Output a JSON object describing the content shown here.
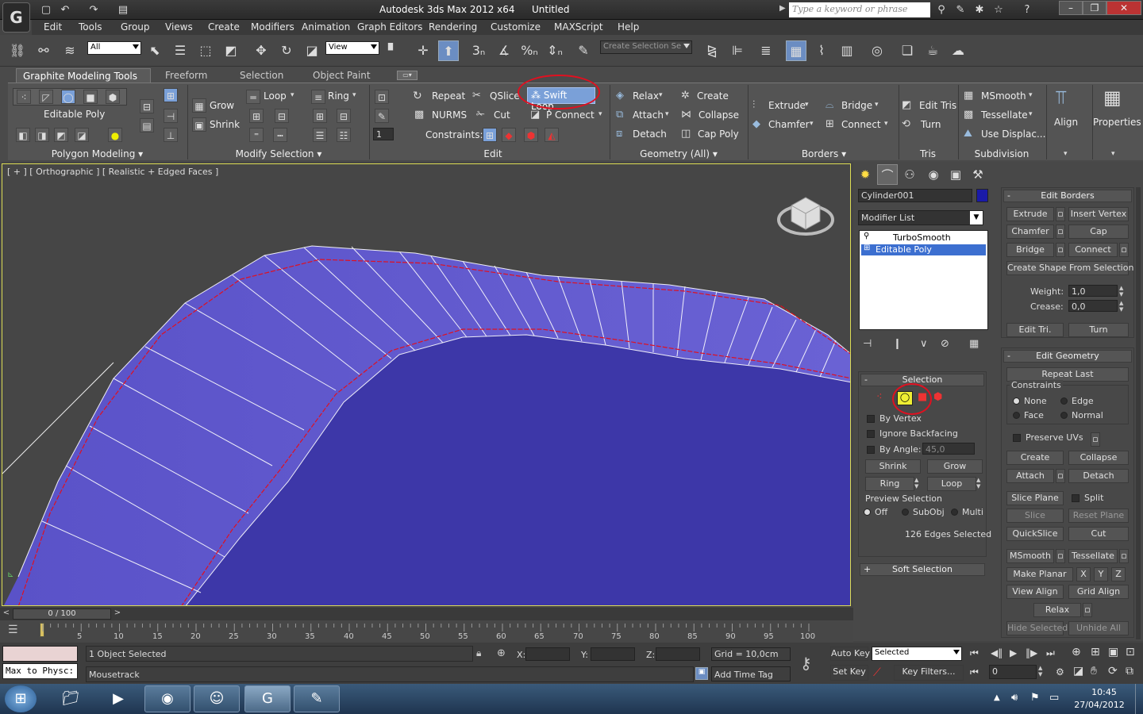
{
  "title_bar": {
    "app_title": "Autodesk 3ds Max  2012 x64",
    "doc_title": "Untitled",
    "search_placeholder": "Type a keyword or phrase"
  },
  "menu": [
    "Edit",
    "Tools",
    "Group",
    "Views",
    "Create",
    "Modifiers",
    "Animation",
    "Graph Editors",
    "Rendering",
    "Customize",
    "MAXScript",
    "Help"
  ],
  "toolbar": {
    "filter_value": "All",
    "refcoord_value": "View",
    "selection_set_placeholder": "Create Selection Se"
  },
  "ribbon": {
    "tabs": [
      "Graphite Modeling Tools",
      "Freeform",
      "Selection",
      "Object Paint"
    ],
    "polygon_modeling": {
      "editable_poly": "Editable Poly",
      "title": "Polygon Modeling"
    },
    "modify_selection": {
      "grow": "Grow",
      "shrink": "Shrink",
      "loop": "Loop",
      "ring": "Ring",
      "title": "Modify Selection"
    },
    "edit": {
      "repeat": "Repeat",
      "qslice": "QSlice",
      "swift_loop": "Swift Loop",
      "nurms": "NURMS",
      "cut": "Cut",
      "p_connect": "P Connect",
      "constraints": "Constraints:",
      "title": "Edit",
      "spinner": "1"
    },
    "geometry": {
      "relax": "Relax",
      "create": "Create",
      "attach": "Attach",
      "collapse": "Collapse",
      "detach": "Detach",
      "cap_poly": "Cap Poly",
      "title": "Geometry (All)"
    },
    "borders": {
      "extrude": "Extrude",
      "bridge": "Bridge",
      "chamfer": "Chamfer",
      "connect": "Connect",
      "title": "Borders"
    },
    "tris": {
      "edit_tris": "Edit Tris",
      "turn": "Turn",
      "title": "Tris"
    },
    "subdivision": {
      "msmooth": "MSmooth",
      "tessellate": "Tessellate",
      "use_displac": "Use Displac...",
      "title": "Subdivision"
    },
    "align": "Align",
    "properties": "Properties"
  },
  "viewport": {
    "label": "[ + ] [ Orthographic ] [ Realistic + Edged Faces ]"
  },
  "command_panel": {
    "object_name": "Cylinder001",
    "object_color": "#1a1aa8",
    "modifier_list": "Modifier List",
    "stack": [
      "TurboSmooth",
      "Editable Poly"
    ],
    "selection": {
      "title": "Selection",
      "by_vertex": "By Vertex",
      "ignore_backfacing": "Ignore Backfacing",
      "by_angle": "By Angle:",
      "angle_value": "45,0",
      "shrink": "Shrink",
      "grow": "Grow",
      "ring": "Ring",
      "loop": "Loop",
      "preview_title": "Preview Selection",
      "off": "Off",
      "subobj": "SubObj",
      "multi": "Multi",
      "count": "126 Edges Selected"
    },
    "soft_selection": "Soft Selection",
    "edit_borders": {
      "title": "Edit Borders",
      "extrude": "Extrude",
      "insert_vertex": "Insert Vertex",
      "chamfer": "Chamfer",
      "cap": "Cap",
      "bridge": "Bridge",
      "connect": "Connect",
      "create_shape": "Create Shape From Selection",
      "weight": "Weight:",
      "weight_val": "1,0",
      "crease": "Crease:",
      "crease_val": "0,0",
      "edit_tri": "Edit Tri.",
      "turn": "Turn"
    },
    "edit_geometry": {
      "title": "Edit Geometry",
      "repeat_last": "Repeat Last",
      "constraints": "Constraints",
      "none": "None",
      "edge": "Edge",
      "face": "Face",
      "normal": "Normal",
      "preserve_uvs": "Preserve UVs",
      "create": "Create",
      "collapse": "Collapse",
      "attach": "Attach",
      "detach": "Detach",
      "slice_plane": "Slice Plane",
      "split": "Split",
      "slice": "Slice",
      "reset_plane": "Reset Plane",
      "quickslice": "QuickSlice",
      "cut": "Cut",
      "msmooth": "MSmooth",
      "tessellate": "Tessellate",
      "make_planar": "Make Planar",
      "x": "X",
      "y": "Y",
      "z": "Z",
      "view_align": "View Align",
      "grid_align": "Grid Align",
      "relax": "Relax",
      "hide_selected": "Hide Selected",
      "unhide_all": "Unhide All"
    }
  },
  "timeline": {
    "frame": "0 / 100",
    "ticks": [
      "5",
      "10",
      "15",
      "20",
      "25",
      "30",
      "35",
      "40",
      "45",
      "50",
      "55",
      "60",
      "65",
      "70",
      "75",
      "80",
      "85",
      "90",
      "95",
      "100"
    ]
  },
  "status": {
    "selected": "1 Object Selected",
    "prompt": "Mousetrack",
    "listener": "Max to Physc:",
    "x_label": "X:",
    "y_label": "Y:",
    "z_label": "Z:",
    "grid": "Grid = 10,0cm",
    "add_time_tag": "Add Time Tag",
    "auto_key": "Auto Key",
    "set_key": "Set Key",
    "key_mode": "Selected",
    "key_filters": "Key Filters...",
    "frame_field": "0"
  },
  "taskbar": {
    "time": "10:45",
    "date": "27/04/2012"
  }
}
